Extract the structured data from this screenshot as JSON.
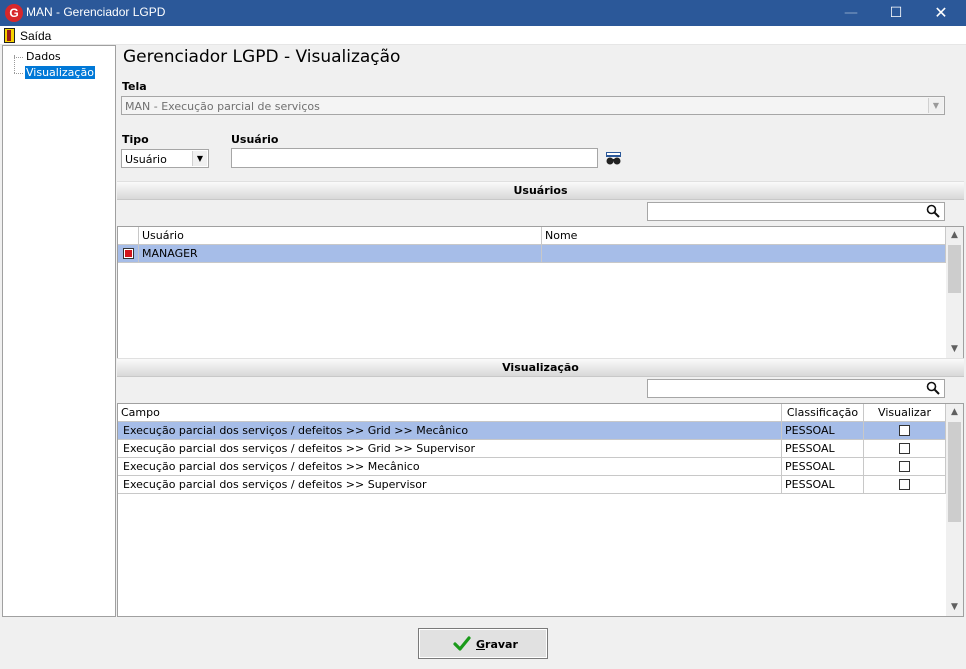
{
  "window": {
    "title": "MAN - Gerenciador LGPD",
    "app_icon_letter": "G",
    "minimize": "—",
    "maximize": "☐",
    "close": "✕"
  },
  "menu": {
    "exit_label": "Saída"
  },
  "tree": {
    "items": [
      {
        "label": "Dados"
      },
      {
        "label": "Visualização",
        "selected": true
      }
    ]
  },
  "page": {
    "title": "Gerenciador LGPD - Visualização"
  },
  "form": {
    "tela_label": "Tela",
    "tela_value": "MAN - Execução parcial de serviços",
    "tipo_label": "Tipo",
    "tipo_value": "Usuário",
    "usuario_label": "Usuário",
    "usuario_value": ""
  },
  "users_section": {
    "header": "Usuários",
    "search_value": "",
    "columns": [
      "",
      "Usuário",
      "Nome"
    ],
    "rows": [
      {
        "checked": true,
        "usuario": "MANAGER",
        "nome": "",
        "selected": true
      }
    ]
  },
  "view_section": {
    "header": "Visualização",
    "search_value": "",
    "columns": [
      "Campo",
      "Classificação",
      "Visualizar"
    ],
    "rows": [
      {
        "campo": "Execução parcial dos serviços / defeitos >> Grid >> Mecânico",
        "classificacao": "PESSOAL",
        "visualizar": false,
        "selected": true
      },
      {
        "campo": "Execução parcial dos serviços / defeitos >> Grid >> Supervisor",
        "classificacao": "PESSOAL",
        "visualizar": false
      },
      {
        "campo": "Execução parcial dos serviços / defeitos >> Mecânico",
        "classificacao": "PESSOAL",
        "visualizar": false
      },
      {
        "campo": "Execução parcial dos serviços / defeitos >> Supervisor",
        "classificacao": "PESSOAL",
        "visualizar": false
      }
    ]
  },
  "actions": {
    "save_mnemonic": "G",
    "save_rest": "ravar"
  },
  "colors": {
    "titlebar": "#2b5899",
    "selection": "#a6bde8",
    "tree_selection": "#0078d7",
    "check_green": "#1a9a1a",
    "check_red": "#d1141b"
  }
}
